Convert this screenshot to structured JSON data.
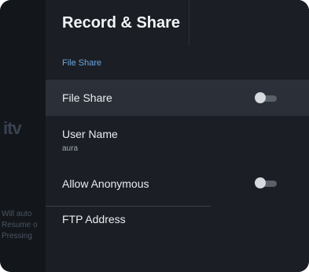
{
  "background_app": {
    "logo_text": "itv",
    "text_lines": [
      "Will auto",
      "Resume o",
      "Pressing"
    ]
  },
  "panel": {
    "title": "Record & Share",
    "section_label": "File Share",
    "rows": [
      {
        "label": "File Share",
        "toggle": "off"
      },
      {
        "label": "User Name",
        "value": "aura"
      },
      {
        "label": "Allow Anonymous",
        "toggle": "off"
      },
      {
        "label": "FTP Address"
      }
    ]
  },
  "colors": {
    "panel_bg": "#1b1f25",
    "highlight_bg": "#2b3038",
    "section_accent": "#6aa6e0"
  }
}
